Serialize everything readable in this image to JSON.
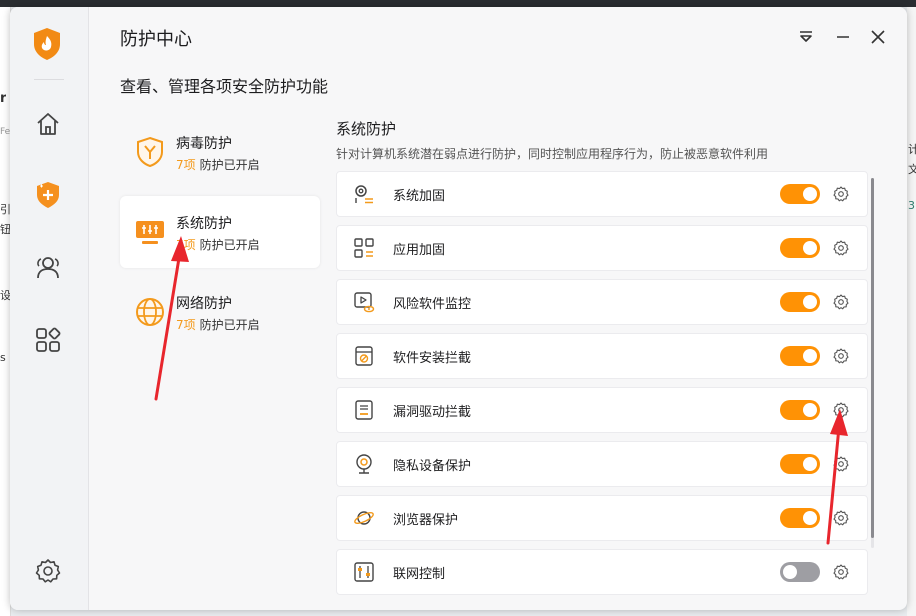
{
  "window": {
    "title": "防护中心",
    "subtitle": "查看、管理各项安全防护功能"
  },
  "sidebar": {
    "items": [
      {
        "icon": "home-icon"
      },
      {
        "icon": "shield-plus-icon"
      },
      {
        "icon": "users-icon"
      },
      {
        "icon": "apps-icon"
      },
      {
        "icon": "gear-icon"
      }
    ]
  },
  "categories": [
    {
      "name": "病毒防护",
      "count": "7项",
      "status": "防护已开启",
      "icon": "virus-shield-icon",
      "active": false
    },
    {
      "name": "系统防护",
      "count": "7项",
      "status": "防护已开启",
      "icon": "system-monitor-icon",
      "active": true
    },
    {
      "name": "网络防护",
      "count": "7项",
      "status": "防护已开启",
      "icon": "globe-icon",
      "active": false
    }
  ],
  "section": {
    "title": "系统防护",
    "description": "针对计算机系统潜在弱点进行防护，同时控制应用程序行为，防止被恶意软件利用"
  },
  "features": [
    {
      "label": "系统加固",
      "enabled": true,
      "icon": "gears-list-icon"
    },
    {
      "label": "应用加固",
      "enabled": true,
      "icon": "apps-list-icon"
    },
    {
      "label": "风险软件监控",
      "enabled": true,
      "icon": "play-eye-icon"
    },
    {
      "label": "软件安装拦截",
      "enabled": true,
      "icon": "install-block-icon"
    },
    {
      "label": "漏洞驱动拦截",
      "enabled": true,
      "icon": "driver-icon"
    },
    {
      "label": "隐私设备保护",
      "enabled": true,
      "icon": "webcam-icon"
    },
    {
      "label": "浏览器保护",
      "enabled": true,
      "icon": "browser-planet-icon"
    },
    {
      "label": "联网控制",
      "enabled": false,
      "icon": "network-sliders-icon"
    }
  ],
  "background": {
    "fragments": [
      "r",
      "Fe",
      "引",
      "钮",
      "设",
      "s",
      "计",
      "文",
      "3"
    ]
  },
  "colors": {
    "accent": "#ff9205",
    "red_arrow": "#e8262d",
    "off": "#9e9ea3"
  }
}
